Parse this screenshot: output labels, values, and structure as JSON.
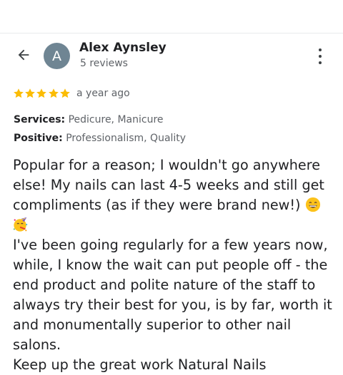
{
  "header": {
    "back_icon": "arrow-back-icon",
    "more_icon": "more-vert-icon"
  },
  "reviewer": {
    "avatar_letter": "A",
    "avatar_color": "#6f8593",
    "name": "Alex Aynsley",
    "review_count": "5 reviews"
  },
  "review": {
    "rating": 5,
    "rating_max": 5,
    "star_color": "#fbbc04",
    "date": "a year ago",
    "services_label": "Services:",
    "services_value": "Pedicure, Manicure",
    "positive_label": "Positive:",
    "positive_value": "Professionalism, Quality",
    "text_part1": "Popular for a reason; I wouldn't go anywhere else! My nails can last 4-5 weeks and still get compliments (as if they were brand new!)",
    "emojis": [
      "grinning-face-emoji",
      "party-face-emoji"
    ],
    "text_part2": "I've been going regularly for a few years now, while, I know the wait can put people off - the end product and polite nature of the staff to always try their best for you, is by far, worth it and monumentally superior to other nail salons.",
    "text_part3": "Keep up the great work Natural Nails"
  }
}
